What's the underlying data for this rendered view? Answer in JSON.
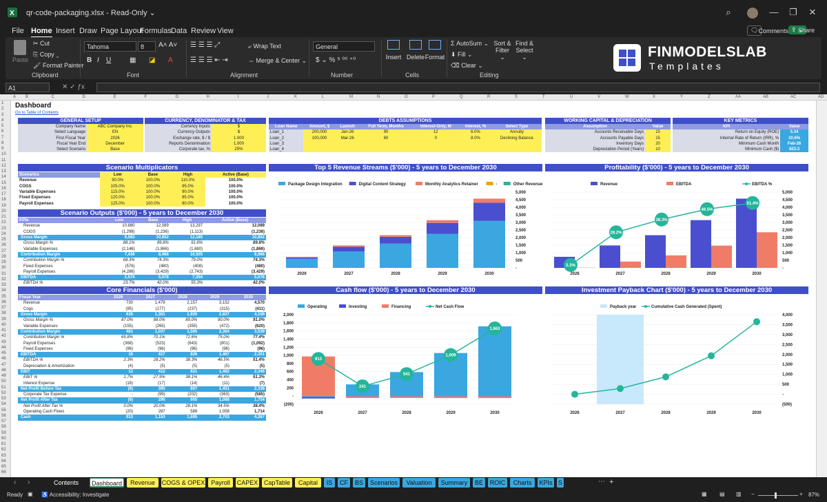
{
  "app": {
    "filename": "qr-code-packaging.xlsx",
    "mode": "Read-Only",
    "comments": "Comments",
    "share": "Share"
  },
  "menu": [
    "File",
    "Home",
    "Insert",
    "Draw",
    "Page Layout",
    "Formulas",
    "Data",
    "Review",
    "View"
  ],
  "ribbon": {
    "paste": "Paste",
    "cut": "Cut",
    "copy": "Copy",
    "format_painter": "Format Painter",
    "clipboard": "Clipboard",
    "font_name": "Tahoma",
    "font_size": "8",
    "font": "Font",
    "wrap": "Wrap Text",
    "merge": "Merge & Center",
    "alignment": "Alignment",
    "numfmt": "General",
    "number": "Number",
    "insert": "Insert",
    "delete": "Delete",
    "format": "Format",
    "cells": "Cells",
    "autosum": "AutoSum",
    "fill": "Fill",
    "clear": "Clear",
    "sort": "Sort & Filter",
    "find": "Find & Select",
    "editing": "Editing"
  },
  "logo": {
    "line1": "FINMODELSLAB",
    "line2": "Templates"
  },
  "namebox": "A1",
  "sheet": {
    "title": "Dashboard",
    "toc": "Go to Table of Contents",
    "cols": [
      "A",
      "B",
      "C",
      "D",
      "E",
      "F",
      "G",
      "H",
      "I",
      "J",
      "K",
      "L",
      "M",
      "N",
      "O",
      "P",
      "Q",
      "R",
      "S",
      "T",
      "U",
      "V",
      "W",
      "X",
      "Y",
      "Z",
      "AA",
      "AB",
      "AC",
      "AD"
    ],
    "general": {
      "title": "GENERAL SETUP",
      "rows": [
        [
          "Company Name",
          "ABC Company Inc."
        ],
        [
          "Select Language",
          "EN"
        ],
        [
          "First Fiscal Year",
          "2026"
        ],
        [
          "Fiscal Year End",
          "December"
        ],
        [
          "Select Scenario",
          "Base"
        ]
      ]
    },
    "currency": {
      "title": "CURRENCY, DENOMINATOR & TAX",
      "rows": [
        [
          "Currency Inputs",
          "$"
        ],
        [
          "Currency Outputs",
          "$"
        ],
        [
          "Exchange rate, $ / $",
          "1.000"
        ],
        [
          "Reports Denomination",
          "1,000"
        ],
        [
          "Corporate tax, %",
          "25%"
        ]
      ]
    },
    "debts": {
      "title": "DEBTS ASSUMPTIONS",
      "headers": [
        "Loan Name",
        "Amount, $",
        "Launch",
        "Full Term, Months",
        "Interest-Only, M",
        "Interest, %",
        "Select Type"
      ],
      "rows": [
        [
          "Loan_1",
          "200,000",
          "Jan-26",
          "90",
          "12",
          "6.0%",
          "Annuity"
        ],
        [
          "Loan_2",
          "100,000",
          "Mar-26",
          "60",
          "0",
          "8.0%",
          "Declining Balance"
        ],
        [
          "Loan_3",
          "",
          "",
          "",
          "",
          "",
          ""
        ],
        [
          "Loan_4",
          "",
          "",
          "",
          "",
          "",
          ""
        ]
      ]
    },
    "wc": {
      "title": "WORKING CAPITAL & DEPRECIATION",
      "headers": [
        "Assumption",
        "Value"
      ],
      "rows": [
        [
          "Accounts Receivable Days",
          "15"
        ],
        [
          "Accounts Payable Days",
          "15"
        ],
        [
          "Inventory Days",
          "20"
        ],
        [
          "Depreciation Period (Years)",
          "10"
        ]
      ]
    },
    "kpis": {
      "title": "KEY METRICS",
      "headers": [
        "KPI",
        "Value"
      ],
      "rows": [
        [
          "Return on Equity (ROE)",
          "5.34"
        ],
        [
          "Internal Rate of Return (IRR), %",
          "10.6%"
        ],
        [
          "Minimum Cash Month",
          "Feb-26"
        ],
        [
          "Minimum Cash ($)",
          "823.3"
        ]
      ]
    },
    "multipliers": {
      "title": "Scenario Multiplicators",
      "headers": [
        "Scenarios",
        "Low",
        "Base",
        "High",
        "Active (Base)"
      ],
      "rows": [
        [
          "Revenue",
          "90.0%",
          "100.0%",
          "110.0%",
          "100.0%"
        ],
        [
          "COGS",
          "105.0%",
          "100.0%",
          "95.0%",
          "100.0%"
        ],
        [
          "Variable Expenses",
          "115.0%",
          "100.0%",
          "90.0%",
          "100.0%"
        ],
        [
          "Fixed Expenses",
          "120.0%",
          "100.0%",
          "85.0%",
          "100.0%"
        ],
        [
          "Payroll Expenses",
          "125.0%",
          "100.0%",
          "80.0%",
          "100.0%"
        ]
      ]
    },
    "outputs": {
      "title": "Scenario Outputs ($'000) - 5 years to December 2030",
      "headers": [
        "KPIs",
        "Low",
        "Base",
        "High",
        "Active (Base)"
      ],
      "rows": [
        [
          "Revenue",
          "10,880",
          "12,089",
          "13,297",
          "12,089",
          ""
        ],
        [
          "COGS",
          "(1,298)",
          "(1,236)",
          "(1,113)",
          "(1,236)",
          ""
        ],
        [
          "Gross Margin",
          "9,583",
          "10,852",
          "12,185",
          "10,852",
          "hl"
        ],
        [
          "Gross Margin %",
          "88.1%",
          "89.8%",
          "91.6%",
          "89.8%",
          "i"
        ],
        [
          "Variable Expenses",
          "(2,146)",
          "(1,866)",
          "(1,680)",
          "(1,866)",
          ""
        ],
        [
          "Contribution Margin",
          "7,436",
          "8,986",
          "10,505",
          "8,986",
          "hl"
        ],
        [
          "Contribution Margin %",
          "68.3%",
          "74.3%",
          "79.0%",
          "74.3%",
          "i"
        ],
        [
          "Fixed Expenses",
          "(576)",
          "(480)",
          "(408)",
          "(480)",
          ""
        ],
        [
          "Payroll Expenses",
          "(4,286)",
          "(3,429)",
          "(2,743)",
          "(3,429)",
          ""
        ],
        [
          "EBITDA",
          "2,574",
          "5,078",
          "7,354",
          "5,078",
          "hl"
        ],
        [
          "EBITDA %",
          "23.7%",
          "42.0%",
          "55.3%",
          "42.0%",
          "i"
        ]
      ]
    },
    "core": {
      "title": "Core Financials ($'000)",
      "headers": [
        "Fiscal Year",
        "2026",
        "2027",
        "2028",
        "2029",
        "2030"
      ],
      "rows": [
        [
          "Revenue",
          "730",
          "1,479",
          "2,157",
          "3,152",
          "4,570",
          ""
        ],
        [
          "Cogs",
          "(95)",
          "(177)",
          "(237)",
          "(315)",
          "(411)",
          ""
        ],
        [
          "Gross Margin",
          "635",
          "1,301",
          "1,920",
          "2,837",
          "4,159",
          "hl"
        ],
        [
          "Gross Margin %",
          "87.0%",
          "88.0%",
          "89.0%",
          "90.0%",
          "91.0%",
          "i"
        ],
        [
          "Variable Expenses",
          "(155)",
          "(265)",
          "(355)",
          "(472)",
          "(620)",
          ""
        ],
        [
          "Contribution Margin",
          "481",
          "1,037",
          "1,565",
          "2,364",
          "3,539",
          "hl"
        ],
        [
          "Contribution Margin %",
          "65.8%",
          "70.1%",
          "72.6%",
          "75.0%",
          "77.4%",
          "i"
        ],
        [
          "Payroll Expenses",
          "(368)",
          "(523)",
          "(643)",
          "(801)",
          "(1,092)",
          ""
        ],
        [
          "Fixed Expenses",
          "(96)",
          "(96)",
          "(96)",
          "(96)",
          "(96)",
          ""
        ],
        [
          "EBITDA",
          "16",
          "417",
          "826",
          "1,467",
          "2,351",
          "hl"
        ],
        [
          "EBITDA %",
          "2.3%",
          "28.2%",
          "38.3%",
          "46.5%",
          "51.4%",
          "i"
        ],
        [
          "Depreciation & Amortization",
          "(4)",
          "(5)",
          "(5)",
          "(5)",
          "(5)",
          ""
        ],
        [
          "EBIT",
          "12",
          "412",
          "821",
          "1,462",
          "2,346",
          "hl"
        ],
        [
          "EBIT %",
          "1.7%",
          "27.9%",
          "38.1%",
          "46.4%",
          "51.3%",
          "i"
        ],
        [
          "Interest Expense",
          "(18)",
          "(17)",
          "(14)",
          "(11)",
          "(7)",
          ""
        ],
        [
          "Net Profit Before Tax",
          "(6)",
          "395",
          "807",
          "1,451",
          "2,338",
          "hl"
        ],
        [
          "Corporate Tax Expense",
          "-",
          "(99)",
          "(202)",
          "(363)",
          "(585)",
          ""
        ],
        [
          "Net Profit After Tax",
          "(6)",
          "296",
          "605",
          "1,088",
          "1,754",
          "hl"
        ],
        [
          "Net Profit After Tax %",
          "0.0%",
          "20.0%",
          "28.1%",
          "34.5%",
          "38.4%",
          "i"
        ],
        [
          "Operating Cash Flows",
          "(20)",
          "287",
          "589",
          "1,058",
          "1,714",
          ""
        ],
        [
          "Cash",
          "913",
          "1,153",
          "1,695",
          "2,703",
          "4,367",
          "hl"
        ]
      ]
    }
  },
  "chart_data": [
    {
      "type": "bar",
      "title": "Top 5 Revenue Streams ($'000) - 5 years to December 2030",
      "categories": [
        "2026",
        "2027",
        "2028",
        "2029",
        "2030"
      ],
      "series": [
        {
          "name": "Package Design Integration",
          "color": "#3aa7e0",
          "values": [
            600,
            1080,
            1600,
            2250,
            3100
          ]
        },
        {
          "name": "Digital Content Strategy",
          "color": "#4a4fd0",
          "values": [
            80,
            310,
            450,
            720,
            1200
          ]
        },
        {
          "name": "Monthly Analytics Retainer",
          "color": "#f07c67",
          "values": [
            50,
            90,
            110,
            180,
            270
          ]
        },
        {
          "name": "-",
          "color": "#f4a000",
          "values": [
            0,
            0,
            0,
            0,
            0
          ]
        },
        {
          "name": "Other Revenue",
          "color": "#24b59a",
          "values": [
            0,
            0,
            0,
            0,
            0
          ]
        }
      ],
      "ylim": [
        0,
        5000
      ],
      "yticks": [
        "-",
        "500",
        "1,000",
        "1,500",
        "2,000",
        "2,500",
        "3,000",
        "3,500",
        "4,000",
        "4,500",
        "5,000"
      ]
    },
    {
      "type": "bar",
      "title": "Profitability ($'000) - 5 years to December 2030",
      "categories": [
        "2026",
        "2027",
        "2028",
        "2029",
        "2030"
      ],
      "series": [
        {
          "name": "Revenue",
          "color": "#4a4fd0",
          "values": [
            730,
            1479,
            2157,
            3152,
            4570
          ]
        },
        {
          "name": "EBITDA",
          "color": "#f07c67",
          "values": [
            16,
            417,
            826,
            1467,
            2351
          ]
        },
        {
          "name": "EBITDA %",
          "color": "#24b59a",
          "values": [
            2.3,
            28.2,
            38.3,
            46.5,
            51.4
          ]
        }
      ],
      "labels": [
        "2.3%",
        "28.2%",
        "38.3%",
        "46.5%",
        "51.4%"
      ],
      "ylim": [
        0,
        5000
      ],
      "yticks": [
        "-",
        "500",
        "1,000",
        "1,500",
        "2,000",
        "2,500",
        "3,000",
        "3,500",
        "4,000",
        "4,500",
        "5,000"
      ]
    },
    {
      "type": "bar",
      "title": "Cash flow ($'000) - 5 years to December 2030",
      "categories": [
        "2026",
        "2027",
        "2028",
        "2029",
        "2030"
      ],
      "series": [
        {
          "name": "Operating",
          "color": "#3aa7e0",
          "values": [
            -20,
            287,
            589,
            1058,
            1714
          ]
        },
        {
          "name": "Investing",
          "color": "#4a4fd0",
          "values": [
            -40,
            -10,
            -10,
            -10,
            -10
          ]
        },
        {
          "name": "Financing",
          "color": "#f07c67",
          "values": [
            973,
            -37,
            -37,
            -39,
            -40
          ]
        },
        {
          "name": "Net Cash Flow",
          "color": "#24b59a",
          "values": [
            913,
            241,
            541,
            1009,
            1663
          ]
        }
      ],
      "labels": [
        "913",
        "241",
        "541",
        "1,009",
        "1,663"
      ],
      "ylim": [
        -200,
        2000
      ],
      "yticks": [
        "(200)",
        "-",
        "200",
        "400",
        "600",
        "800",
        "1,000",
        "1,200",
        "1,400",
        "1,600",
        "1,800",
        "2,000"
      ]
    },
    {
      "type": "line",
      "title": "Investment Payback Chart ($'000) - 5 years to December 2030",
      "categories": [
        "2026",
        "2027",
        "2028",
        "2029",
        "2030"
      ],
      "series": [
        {
          "name": "Payback year",
          "color": "#c8e8fb",
          "values": [
            0,
            1,
            0,
            0,
            0
          ]
        },
        {
          "name": "Cumulative Cash Generated (Spent)",
          "color": "#24b59a",
          "values": [
            0,
            287,
            876,
            1934,
            3648
          ]
        }
      ],
      "ylim": [
        -500,
        4000
      ],
      "yticks": [
        "(500)",
        "-",
        "500",
        "1,000",
        "1,500",
        "2,000",
        "2,500",
        "3,000",
        "3,500",
        "4,000"
      ]
    }
  ],
  "tabs": [
    {
      "label": "Contents",
      "color": "#1f1f1f",
      "text": "#fff"
    },
    {
      "label": "Dashboard",
      "color": "#ffffff",
      "text": "#111",
      "active": true
    },
    {
      "label": "Revenue",
      "color": "#ffef57"
    },
    {
      "label": "COGS & OPEX",
      "color": "#ffef57"
    },
    {
      "label": "Payroll",
      "color": "#ffef57"
    },
    {
      "label": "CAPEX",
      "color": "#ffef57"
    },
    {
      "label": "CapTable",
      "color": "#ffef57"
    },
    {
      "label": "Capital",
      "color": "#ffef57"
    },
    {
      "label": "IS",
      "color": "#3aa7e0"
    },
    {
      "label": "CF",
      "color": "#3aa7e0"
    },
    {
      "label": "BS",
      "color": "#3aa7e0"
    },
    {
      "label": "Scenarios",
      "color": "#3aa7e0"
    },
    {
      "label": "Valuation",
      "color": "#3aa7e0"
    },
    {
      "label": "Summary",
      "color": "#3aa7e0"
    },
    {
      "label": "BE",
      "color": "#3aa7e0"
    },
    {
      "label": "ROIC",
      "color": "#3aa7e0"
    },
    {
      "label": "Charts",
      "color": "#3aa7e0"
    },
    {
      "label": "KPIs",
      "color": "#3aa7e0"
    },
    {
      "label": "S",
      "color": "#3aa7e0"
    }
  ],
  "status": {
    "ready": "Ready",
    "access": "Accessibility: Investigate",
    "zoom": "87%"
  }
}
